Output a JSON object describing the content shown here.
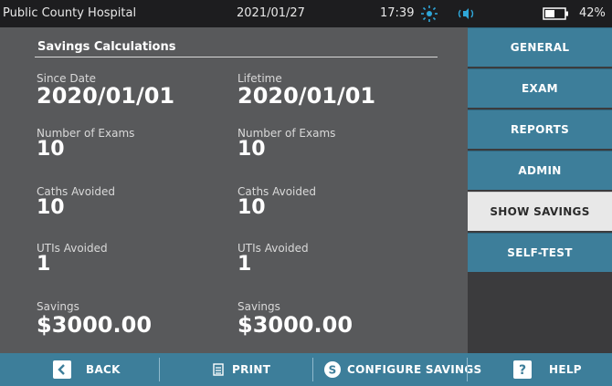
{
  "status_bar": {
    "hospital": "Public County Hospital",
    "date": "2021/01/27",
    "time": "17:39",
    "battery_percent": "42%"
  },
  "savings": {
    "title": "Savings Calculations",
    "since": {
      "date_label": "Since Date",
      "date_value": "2020/01/01",
      "exams_label": "Number of Exams",
      "exams_value": "10",
      "caths_label": "Caths Avoided",
      "caths_value": "10",
      "utis_label": "UTIs Avoided",
      "utis_value": "1",
      "savings_label": "Savings",
      "savings_value": "$3000.00"
    },
    "lifetime": {
      "date_label": "Lifetime",
      "date_value": "2020/01/01",
      "exams_label": "Number of Exams",
      "exams_value": "10",
      "caths_label": "Caths Avoided",
      "caths_value": "10",
      "utis_label": "UTIs Avoided",
      "utis_value": "1",
      "savings_label": "Savings",
      "savings_value": "$3000.00"
    }
  },
  "menu": {
    "items": [
      "GENERAL",
      "EXAM",
      "REPORTS",
      "ADMIN",
      "SHOW SAVINGS",
      "SELF-TEST"
    ],
    "active": "SHOW SAVINGS"
  },
  "bottom_bar": {
    "back": "BACK",
    "print": "PRINT",
    "configure": "CONFIGURE SAVINGS",
    "help": "HELP"
  },
  "colors": {
    "accent": "#3d7e9a",
    "content_bg": "#58595b",
    "status_bg": "#1d1d1f",
    "active_item_bg": "#e8e8e8"
  },
  "icons": [
    "sun-icon",
    "speaker-icon",
    "battery-icon",
    "chevron-left-icon",
    "print-icon",
    "savings-coin-icon",
    "help-icon"
  ]
}
